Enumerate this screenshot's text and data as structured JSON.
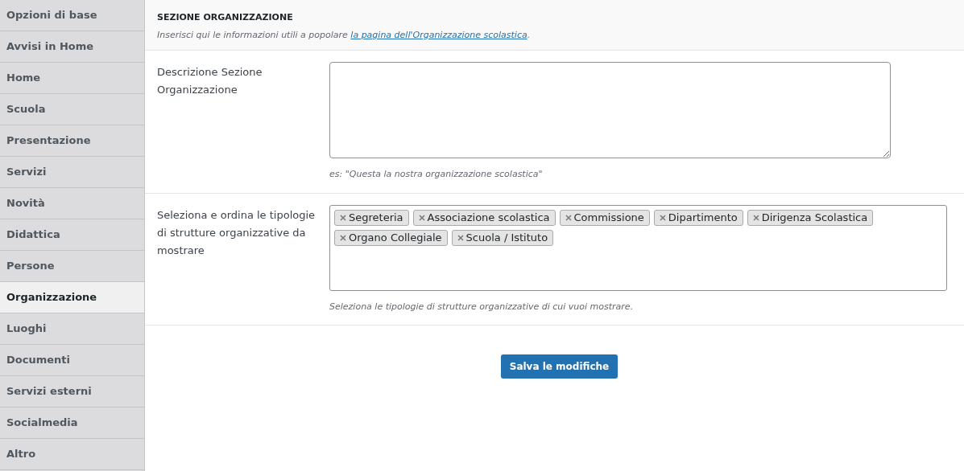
{
  "sidebar": {
    "items": [
      {
        "label": "Opzioni di base",
        "selected": false
      },
      {
        "label": "Avvisi in Home",
        "selected": false
      },
      {
        "label": "Home",
        "selected": false
      },
      {
        "label": "Scuola",
        "selected": false
      },
      {
        "label": "Presentazione",
        "selected": false
      },
      {
        "label": "Servizi",
        "selected": false
      },
      {
        "label": "Novità",
        "selected": false
      },
      {
        "label": "Didattica",
        "selected": false
      },
      {
        "label": "Persone",
        "selected": false
      },
      {
        "label": "Organizzazione",
        "selected": true
      },
      {
        "label": "Luoghi",
        "selected": false
      },
      {
        "label": "Documenti",
        "selected": false
      },
      {
        "label": "Servizi esterni",
        "selected": false
      },
      {
        "label": "Socialmedia",
        "selected": false
      },
      {
        "label": "Altro",
        "selected": false
      }
    ]
  },
  "section": {
    "title": "SEZIONE ORGANIZZAZIONE",
    "description_before": "Inserisci qui le informazioni utili a popolare",
    "description_link": "la pagina dell'Organizzazione scolastica",
    "description_after": "."
  },
  "fields": [
    {
      "kind": "textarea",
      "label": "Descrizione Sezione Organizzazione",
      "help": "es: \"Questa la nostra organizzazione scolastica\""
    },
    {
      "kind": "tags",
      "label": "Seleziona e ordina le tipologie di strutture organizzative da mostrare",
      "tags": [
        "Segreteria",
        "Associazione scolastica",
        "Commissione",
        "Dipartimento",
        "Dirigenza Scolastica",
        "Organo Collegiale",
        "Scuola / Istituto"
      ],
      "help": "Seleziona le tipologie di strutture organizzative di cui vuoi mostrare."
    }
  ],
  "save_button": "Salva le modifiche"
}
